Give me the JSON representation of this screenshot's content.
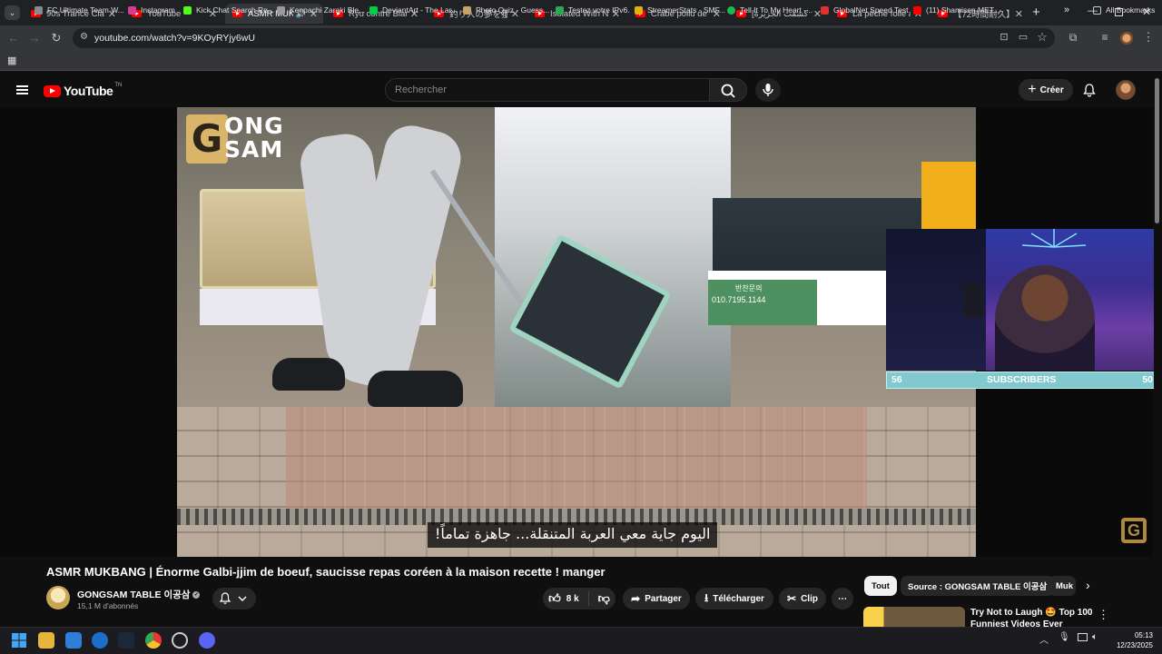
{
  "browser": {
    "tabs": [
      {
        "title": "90s Trance Classic",
        "active": false
      },
      {
        "title": "YouTube",
        "active": false
      },
      {
        "title": "ASMR MUKBA",
        "active": true,
        "audio": true
      },
      {
        "title": "Ryu contre Blanka",
        "active": false
      },
      {
        "title": "釣り人の夢を獲った",
        "active": false
      },
      {
        "title": "Isolated With NO",
        "active": false
      },
      {
        "title": "Crabe poilu de Sa",
        "active": false
      },
      {
        "title": "[كشفت الجزيرة ...",
        "active": false
      },
      {
        "title": "La pêche folle au",
        "active": false
      },
      {
        "title": "【72時間耐久】3泊",
        "active": false
      }
    ],
    "new_tab": "+",
    "url": "youtube.com/watch?v=9KOyRYjy6wU",
    "bookmarks": [
      {
        "label": "FC Ultimate Team W...",
        "color": "#8a8a8a"
      },
      {
        "label": "Instagram",
        "color": "#d63c8f"
      },
      {
        "label": "Kick Chat Search Re...",
        "color": "#53fc18"
      },
      {
        "label": "Kenpachi Zaraki Ble...",
        "color": "#9a9a9a"
      },
      {
        "label": "DeviantArt - The Lar...",
        "color": "#05cc47"
      },
      {
        "label": "Photo Quiz - Guess...",
        "color": "#c7a26b"
      },
      {
        "label": "Testez votre IPv6.",
        "color": "#2fa84f"
      },
      {
        "label": "StreamerStats - SMF...",
        "color": "#e0b010"
      },
      {
        "label": "Tell It To My Heart -...",
        "color": "#1db954"
      },
      {
        "label": "GlobalNet Speed Test",
        "color": "#d33"
      },
      {
        "label": "(11) Shamisen MET...",
        "color": "#ff0000"
      }
    ],
    "bookmarks_more": "»",
    "all_bookmarks": "All Bookmarks"
  },
  "youtube": {
    "logo_text": "YouTube",
    "logo_sup": "TN",
    "search_placeholder": "Rechercher",
    "create_label": "Créer",
    "video": {
      "logo_line1": "ONG",
      "logo_line2": "SAM",
      "logo_g": "G",
      "subtitle": "اليوم جاية معي العربة المتنقلة... جاهزة تماماً!",
      "watermark": "G",
      "shop_sign": "반찬문의",
      "shop_phone": "010.7195.1144"
    },
    "webcam": {
      "left_count": "56",
      "label": "SUBSCRIBERS",
      "right_count": "50"
    },
    "title": "ASMR MUKBANG | Énorme Galbi-jjim de boeuf, saucisse repas coréen à la maison recette ! manger",
    "channel": {
      "name": "GONGSAM TABLE 이공삼",
      "subscribers": "15,1 M d'abonnés"
    },
    "actions": {
      "likes": "8 k",
      "share": "Partager",
      "download": "Télécharger",
      "clip": "Clip"
    },
    "chips": [
      "Tout",
      "Source : GONGSAM TABLE 이공삼",
      "Muk"
    ],
    "recommendation": {
      "title": "Try Not to Laugh 🤩 Top 100 Funniest Videos Ever"
    }
  },
  "taskbar": {
    "time": "05:13",
    "date": "12/23/2025"
  }
}
